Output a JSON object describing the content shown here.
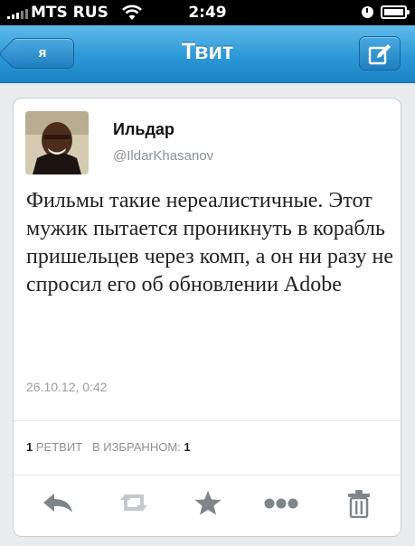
{
  "status_bar": {
    "carrier": "MTS RUS",
    "time": "2:49"
  },
  "nav": {
    "back_label": "я",
    "title": "Твит"
  },
  "tweet": {
    "author_name": "Ильдар",
    "author_handle": "@IldarKhasanov",
    "text": "Фильмы такие нереалистичные. Этот мужик пытается проникнуть в корабль пришельцев через комп, а он ни разу не спросил его об обновлении Adobe",
    "timestamp": "26.10.12, 0:42",
    "retweets_count": "1",
    "retweets_label": "РЕТВИТ",
    "favorites_label": "В ИЗБРАННОМ:",
    "favorites_count": "1"
  },
  "actions": [
    "reply-icon",
    "retweet-icon",
    "favorite-icon",
    "more-icon",
    "delete-icon"
  ],
  "colors": {
    "nav_blue": "#2c98d7",
    "text": "#222222",
    "muted": "#8c9196"
  }
}
